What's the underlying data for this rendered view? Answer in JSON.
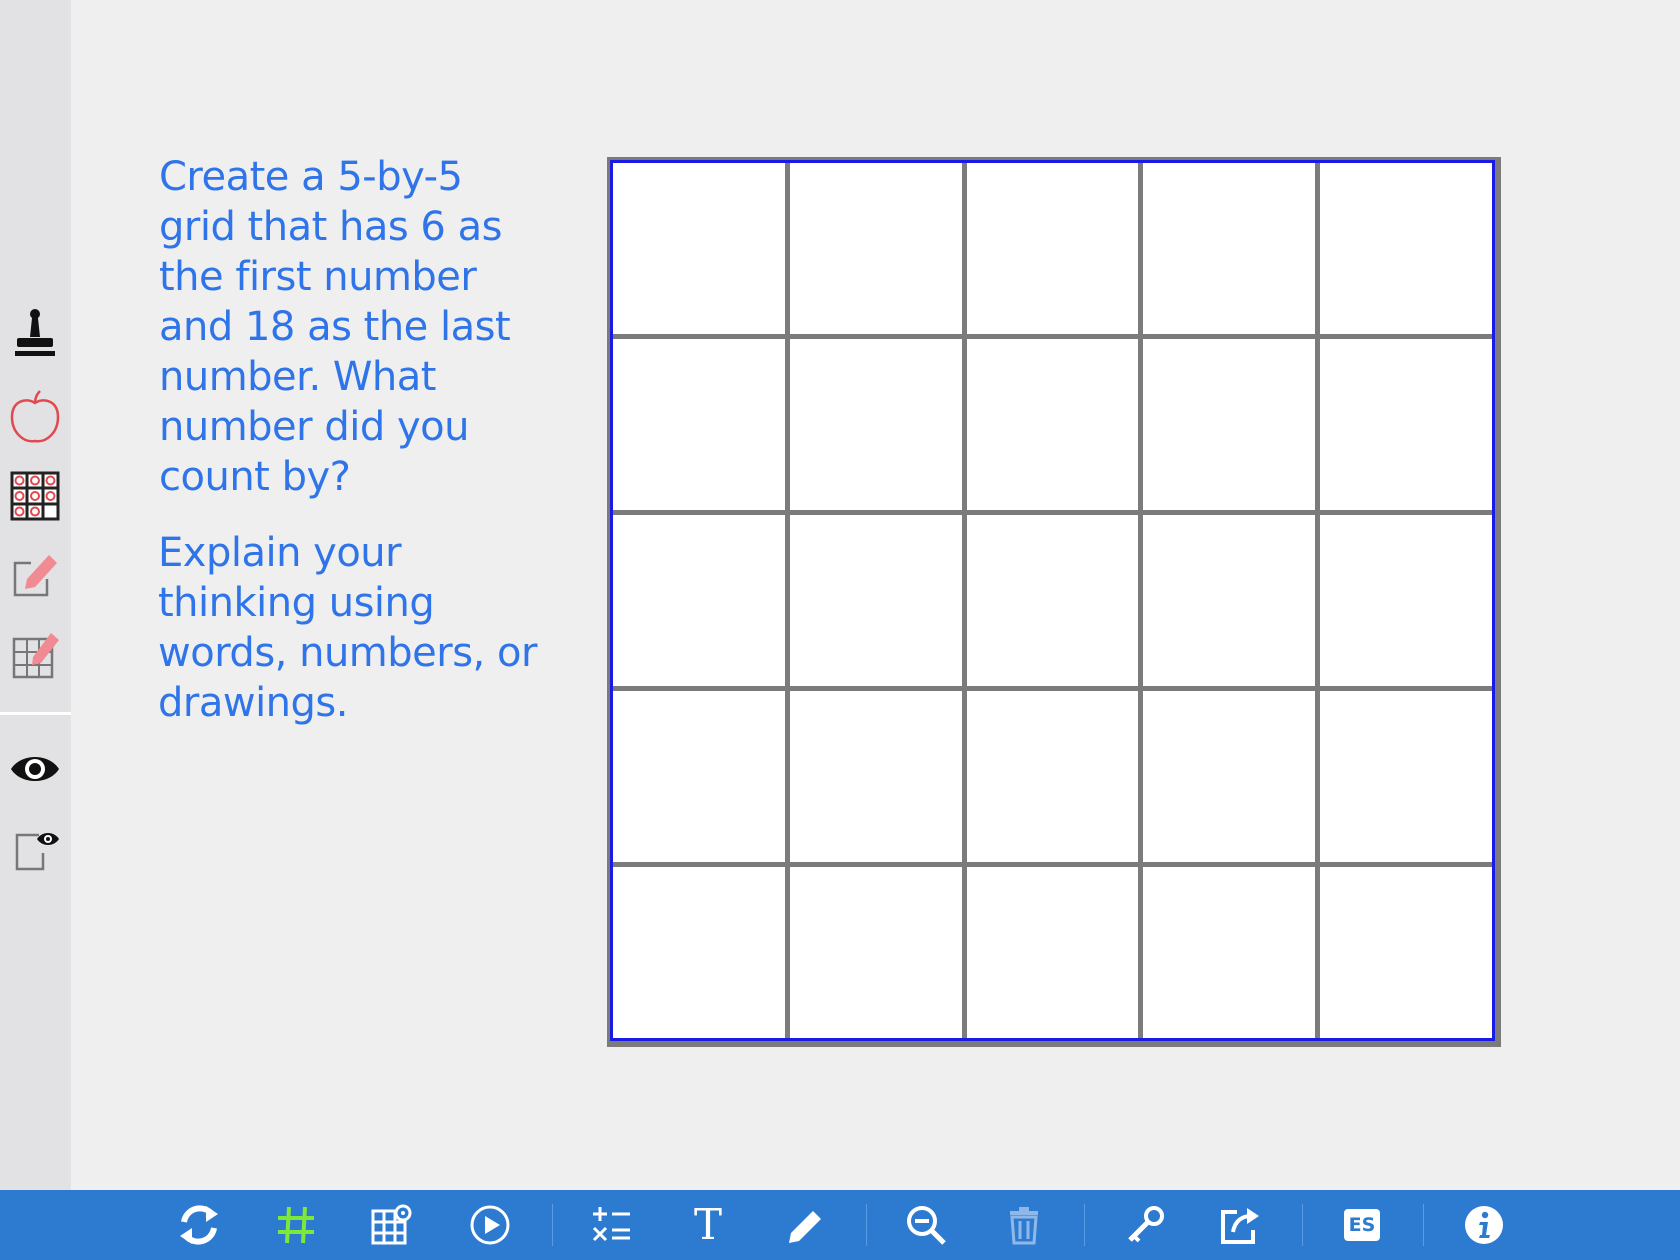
{
  "prompt": {
    "question": "Create a 5-by-5 grid that has 6 as the first number and 18 as the last number. What number did you count by?",
    "instruction": "Explain your thinking using words, numbers, or drawings."
  },
  "grid": {
    "rows": 5,
    "columns": 5
  },
  "sidebar": {
    "tools": [
      "stamp-icon",
      "apple-icon",
      "grid-counters-icon",
      "note-pencil-icon",
      "table-pencil-icon",
      "eye-icon",
      "note-eye-icon"
    ]
  },
  "toolbar": {
    "buttons": [
      "refresh-icon",
      "hash-icon",
      "grid-settings-icon",
      "play-icon",
      "equation-icon",
      "text-icon",
      "pencil-icon",
      "zoom-out-icon",
      "trash-icon",
      "key-icon",
      "share-icon",
      "language-icon",
      "info-icon"
    ],
    "language_label": "ES",
    "text_tool_label": "T"
  },
  "colors": {
    "toolbar": "#2d7bd0",
    "prompt_text": "#2f74e8",
    "grid_border": "#1a1ae6",
    "grid_lines": "#7b7b7b",
    "highlight": "#7ee83a"
  }
}
